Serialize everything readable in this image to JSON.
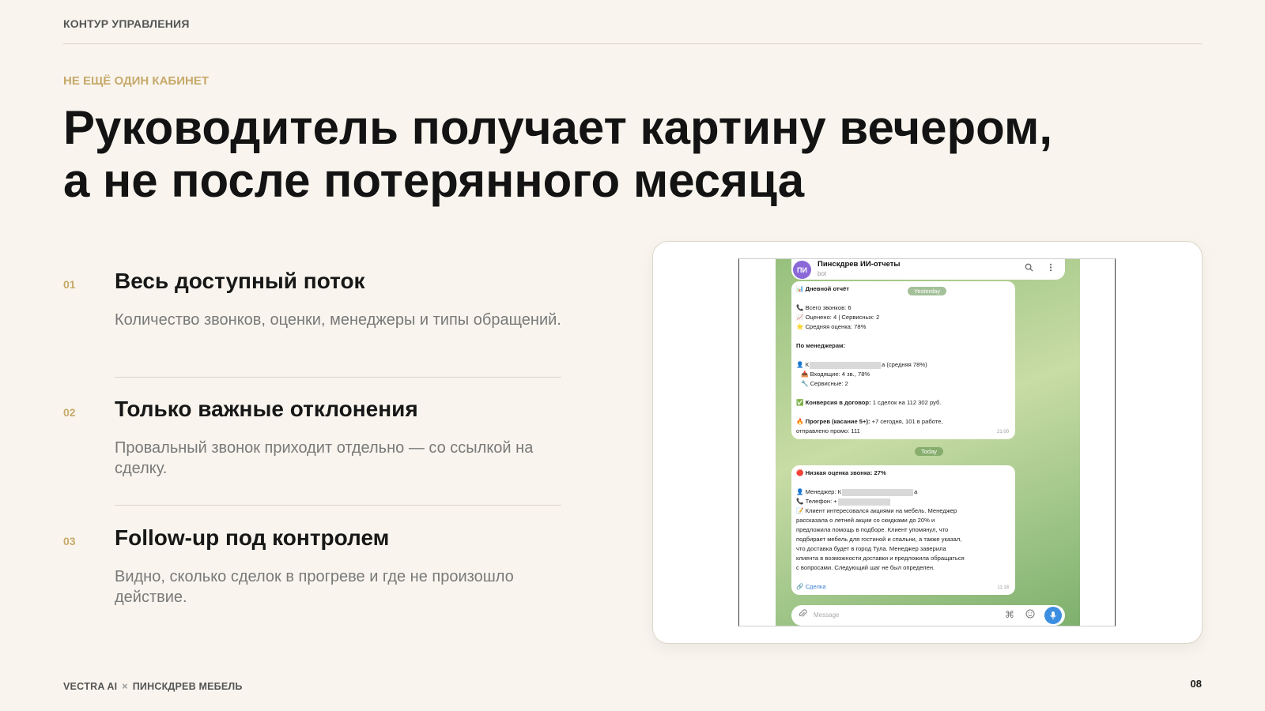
{
  "header": {
    "section_label": "КОНТУР УПРАВЛЕНИЯ"
  },
  "eyebrow": "НЕ ЕЩЁ ОДИН КАБИНЕТ",
  "headline": {
    "line1": "Руководитель получает картину вечером,",
    "line2": "а не после потерянного месяца"
  },
  "features": [
    {
      "num": "01",
      "title": "Весь доступный поток",
      "desc": "Количество звонков, оценки, менеджеры и типы обращений."
    },
    {
      "num": "02",
      "title": "Только важные отклонения",
      "desc": "Провальный звонок приходит отдельно — со ссылкой на сделку."
    },
    {
      "num": "03",
      "title": "Follow-up под контролем",
      "desc": "Видно, сколько сделок в прогреве и где не произошло действие."
    }
  ],
  "telegram": {
    "avatar_initials": "ПИ",
    "chat_name": "Пинскдрев ИИ-отчеты",
    "chat_sub": "bot",
    "search_icon": "search-icon",
    "menu_icon": "more-vertical-icon",
    "day_yesterday": "Yesterday",
    "day_today": "Today",
    "daily_report": {
      "title": "📊 Дневной отчёт",
      "total_calls": "📞 Всего звонков: 6",
      "rated": "📈 Оценено: 4 | Сервисных: 2",
      "avg_score": "⭐ Средняя оценка: 78%",
      "by_managers": "По менеджерам:",
      "manager_prefix": "👤 К",
      "manager_suffix": "а (средняя 78%)",
      "incoming": "📥 Входящие: 4 зв., 78%",
      "service": "🔧 Сервисные: 2",
      "conversion_label": "✅ Конверсия в договор:",
      "conversion_value": " 1 сделок на 112 302 руб.",
      "warmup_label": "🔥 Прогрев (касание 5+):",
      "warmup_value": " +7 сегодня, 101 в работе,",
      "promo": "отправлено промо: 111",
      "time": "21:00"
    },
    "alert": {
      "title": "🔴 Низкая оценка звонка: 27%",
      "manager_prefix": "👤 Менеджер: К",
      "manager_suffix": "а",
      "phone_prefix": "📞 Телефон: +",
      "summary_lines": [
        "📝 Клиент интересовался акциями на мебель. Менеджер",
        "рассказала о летней акции со скидками до 20% и",
        "предложила помощь в подборе. Клиент упомянул, что",
        "подбирает мебель для гостиной и спальни, а также указал,",
        "что доставка будет в город Тула. Менеджер заверила",
        "клиента в возможности доставки и предложила обращаться",
        "с вопросами. Следующий шаг не был определен."
      ],
      "deal_link": "🔗 Сделка",
      "time": "11:18"
    },
    "composer_placeholder": "Message"
  },
  "footer": {
    "brand_left": "VECTRA AI",
    "separator": "×",
    "brand_right": "ПИНСКДРЕВ МЕБЕЛЬ",
    "page_number": "08"
  }
}
